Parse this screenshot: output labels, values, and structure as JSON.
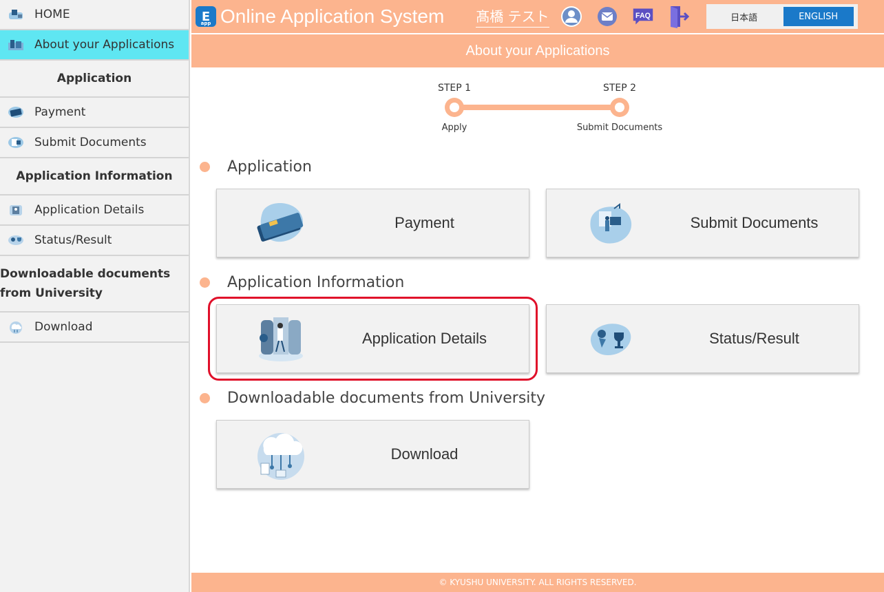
{
  "sidebar": {
    "home": "HOME",
    "about": "About your Applications",
    "section_application": "Application",
    "payment": "Payment",
    "submit_documents": "Submit Documents",
    "section_app_info": "Application Information",
    "application_details": "Application Details",
    "status_result": "Status/Result",
    "section_downloadable": "Downloadable documents from University",
    "download": "Download"
  },
  "header": {
    "logo_letter": "E",
    "logo_sub": "app",
    "title": "Online Application System",
    "user_name": "髙橋 テスト",
    "faq": "FAQ",
    "lang_jp": "日本語",
    "lang_en": "ENGLISH",
    "accent": "#fcb48e",
    "brand": "#1a79c9"
  },
  "page": {
    "title": "About your Applications"
  },
  "steps": {
    "step1": "STEP 1",
    "step1_label": "Apply",
    "step2": "STEP 2",
    "step2_label": "Submit Documents"
  },
  "sections": {
    "application": "Application",
    "app_info": "Application Information",
    "downloadable": "Downloadable documents from University"
  },
  "cards": {
    "payment": "Payment",
    "submit_documents": "Submit Documents",
    "application_details": "Application Details",
    "status_result": "Status/Result",
    "download": "Download"
  },
  "footer": "© KYUSHU UNIVERSITY. ALL RIGHTS RESERVED."
}
